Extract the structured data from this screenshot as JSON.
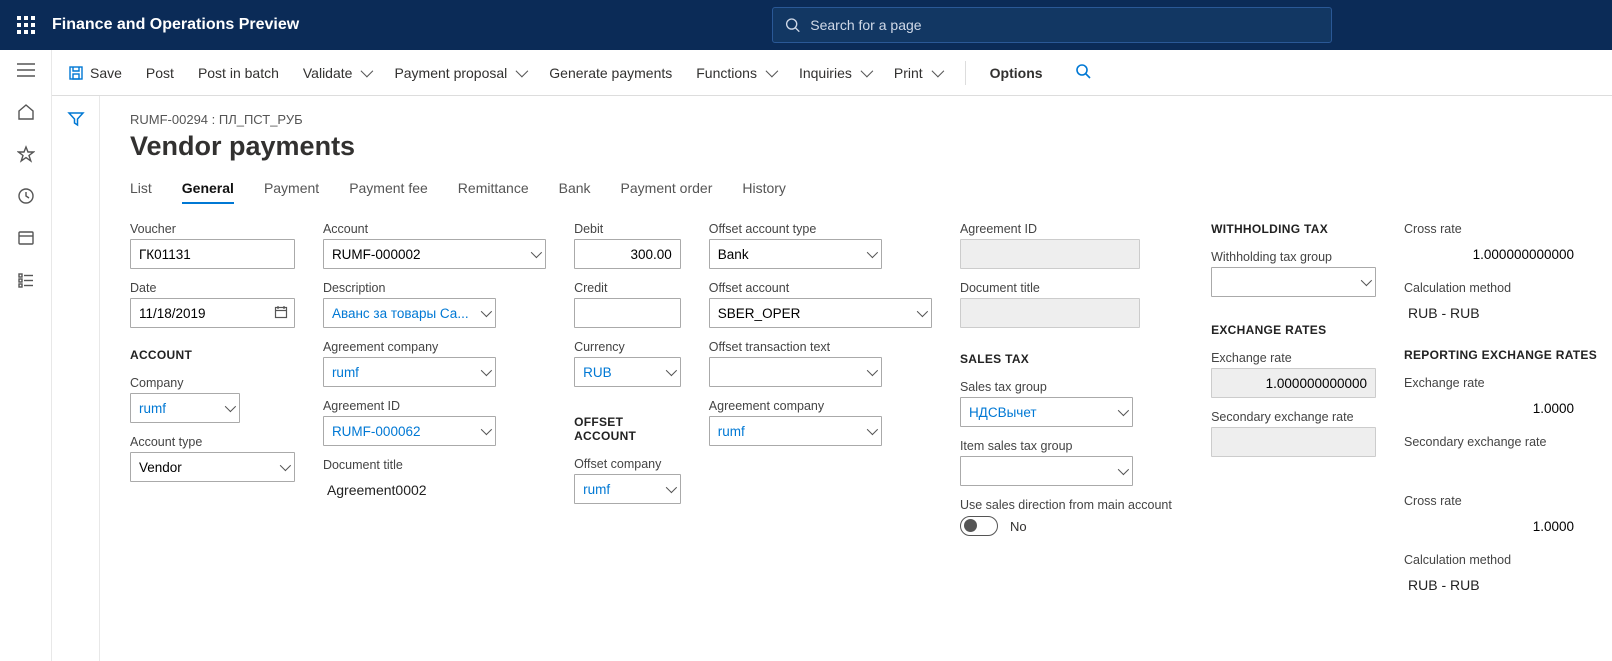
{
  "app_title": "Finance and Operations Preview",
  "search_placeholder": "Search for a page",
  "actions": {
    "save": "Save",
    "post": "Post",
    "post_batch": "Post in batch",
    "validate": "Validate",
    "payment_proposal": "Payment proposal",
    "generate_payments": "Generate payments",
    "functions": "Functions",
    "inquiries": "Inquiries",
    "print": "Print",
    "options": "Options"
  },
  "breadcrumb": "RUMF-00294 : ПЛ_ПСТ_РУБ",
  "page_title": "Vendor payments",
  "tabs": [
    "List",
    "General",
    "Payment",
    "Payment fee",
    "Remittance",
    "Bank",
    "Payment order",
    "History"
  ],
  "active_tab_index": 1,
  "col1": {
    "voucher_label": "Voucher",
    "voucher": "ГК01131",
    "date_label": "Date",
    "date": "11/18/2019",
    "section_account": "ACCOUNT",
    "company_label": "Company",
    "company": "rumf",
    "account_type_label": "Account type",
    "account_type": "Vendor"
  },
  "col2": {
    "account_label": "Account",
    "account": "RUMF-000002",
    "description_label": "Description",
    "description": "Аванс за товары Са...",
    "agreement_company_label": "Agreement company",
    "agreement_company": "rumf",
    "agreement_id_label": "Agreement ID",
    "agreement_id": "RUMF-000062",
    "document_title_label": "Document title",
    "document_title": "Agreement0002"
  },
  "col3": {
    "debit_label": "Debit",
    "debit": "300.00",
    "credit_label": "Credit",
    "credit": "",
    "currency_label": "Currency",
    "currency": "RUB",
    "section_offset": "OFFSET ACCOUNT",
    "offset_company_label": "Offset company",
    "offset_company": "rumf"
  },
  "col4": {
    "offset_account_type_label": "Offset account type",
    "offset_account_type": "Bank",
    "offset_account_label": "Offset account",
    "offset_account": "SBER_OPER",
    "offset_txn_text_label": "Offset transaction text",
    "offset_txn_text": "",
    "agreement_company_label": "Agreement company",
    "agreement_company": "rumf"
  },
  "col5": {
    "agreement_id_label": "Agreement ID",
    "agreement_id": "",
    "document_title_label": "Document title",
    "document_title": "",
    "section_sales_tax": "SALES TAX",
    "sales_tax_group_label": "Sales tax group",
    "sales_tax_group": "НДСВычет",
    "item_sales_tax_group_label": "Item sales tax group",
    "item_sales_tax_group": "",
    "use_sales_dir_label": "Use sales direction from main account",
    "use_sales_dir_value": "No"
  },
  "col6": {
    "section_withholding": "WITHHOLDING TAX",
    "withholding_group_label": "Withholding tax group",
    "withholding_group": "",
    "section_exchange": "EXCHANGE RATES",
    "exchange_rate_label": "Exchange rate",
    "exchange_rate": "1.000000000000",
    "secondary_rate_label": "Secondary exchange rate",
    "secondary_rate": ""
  },
  "col7": {
    "cross_rate_label": "Cross rate",
    "cross_rate": "1.000000000000",
    "calc_method_label": "Calculation method",
    "calc_method": "RUB - RUB",
    "section_reporting": "REPORTING EXCHANGE RATES",
    "exchange_rate_label": "Exchange rate",
    "exchange_rate": "1.0000",
    "secondary_rate_label": "Secondary exchange rate",
    "secondary_rate": "",
    "cross_rate2_label": "Cross rate",
    "cross_rate2": "1.0000",
    "calc_method2_label": "Calculation method",
    "calc_method2": "RUB - RUB"
  }
}
